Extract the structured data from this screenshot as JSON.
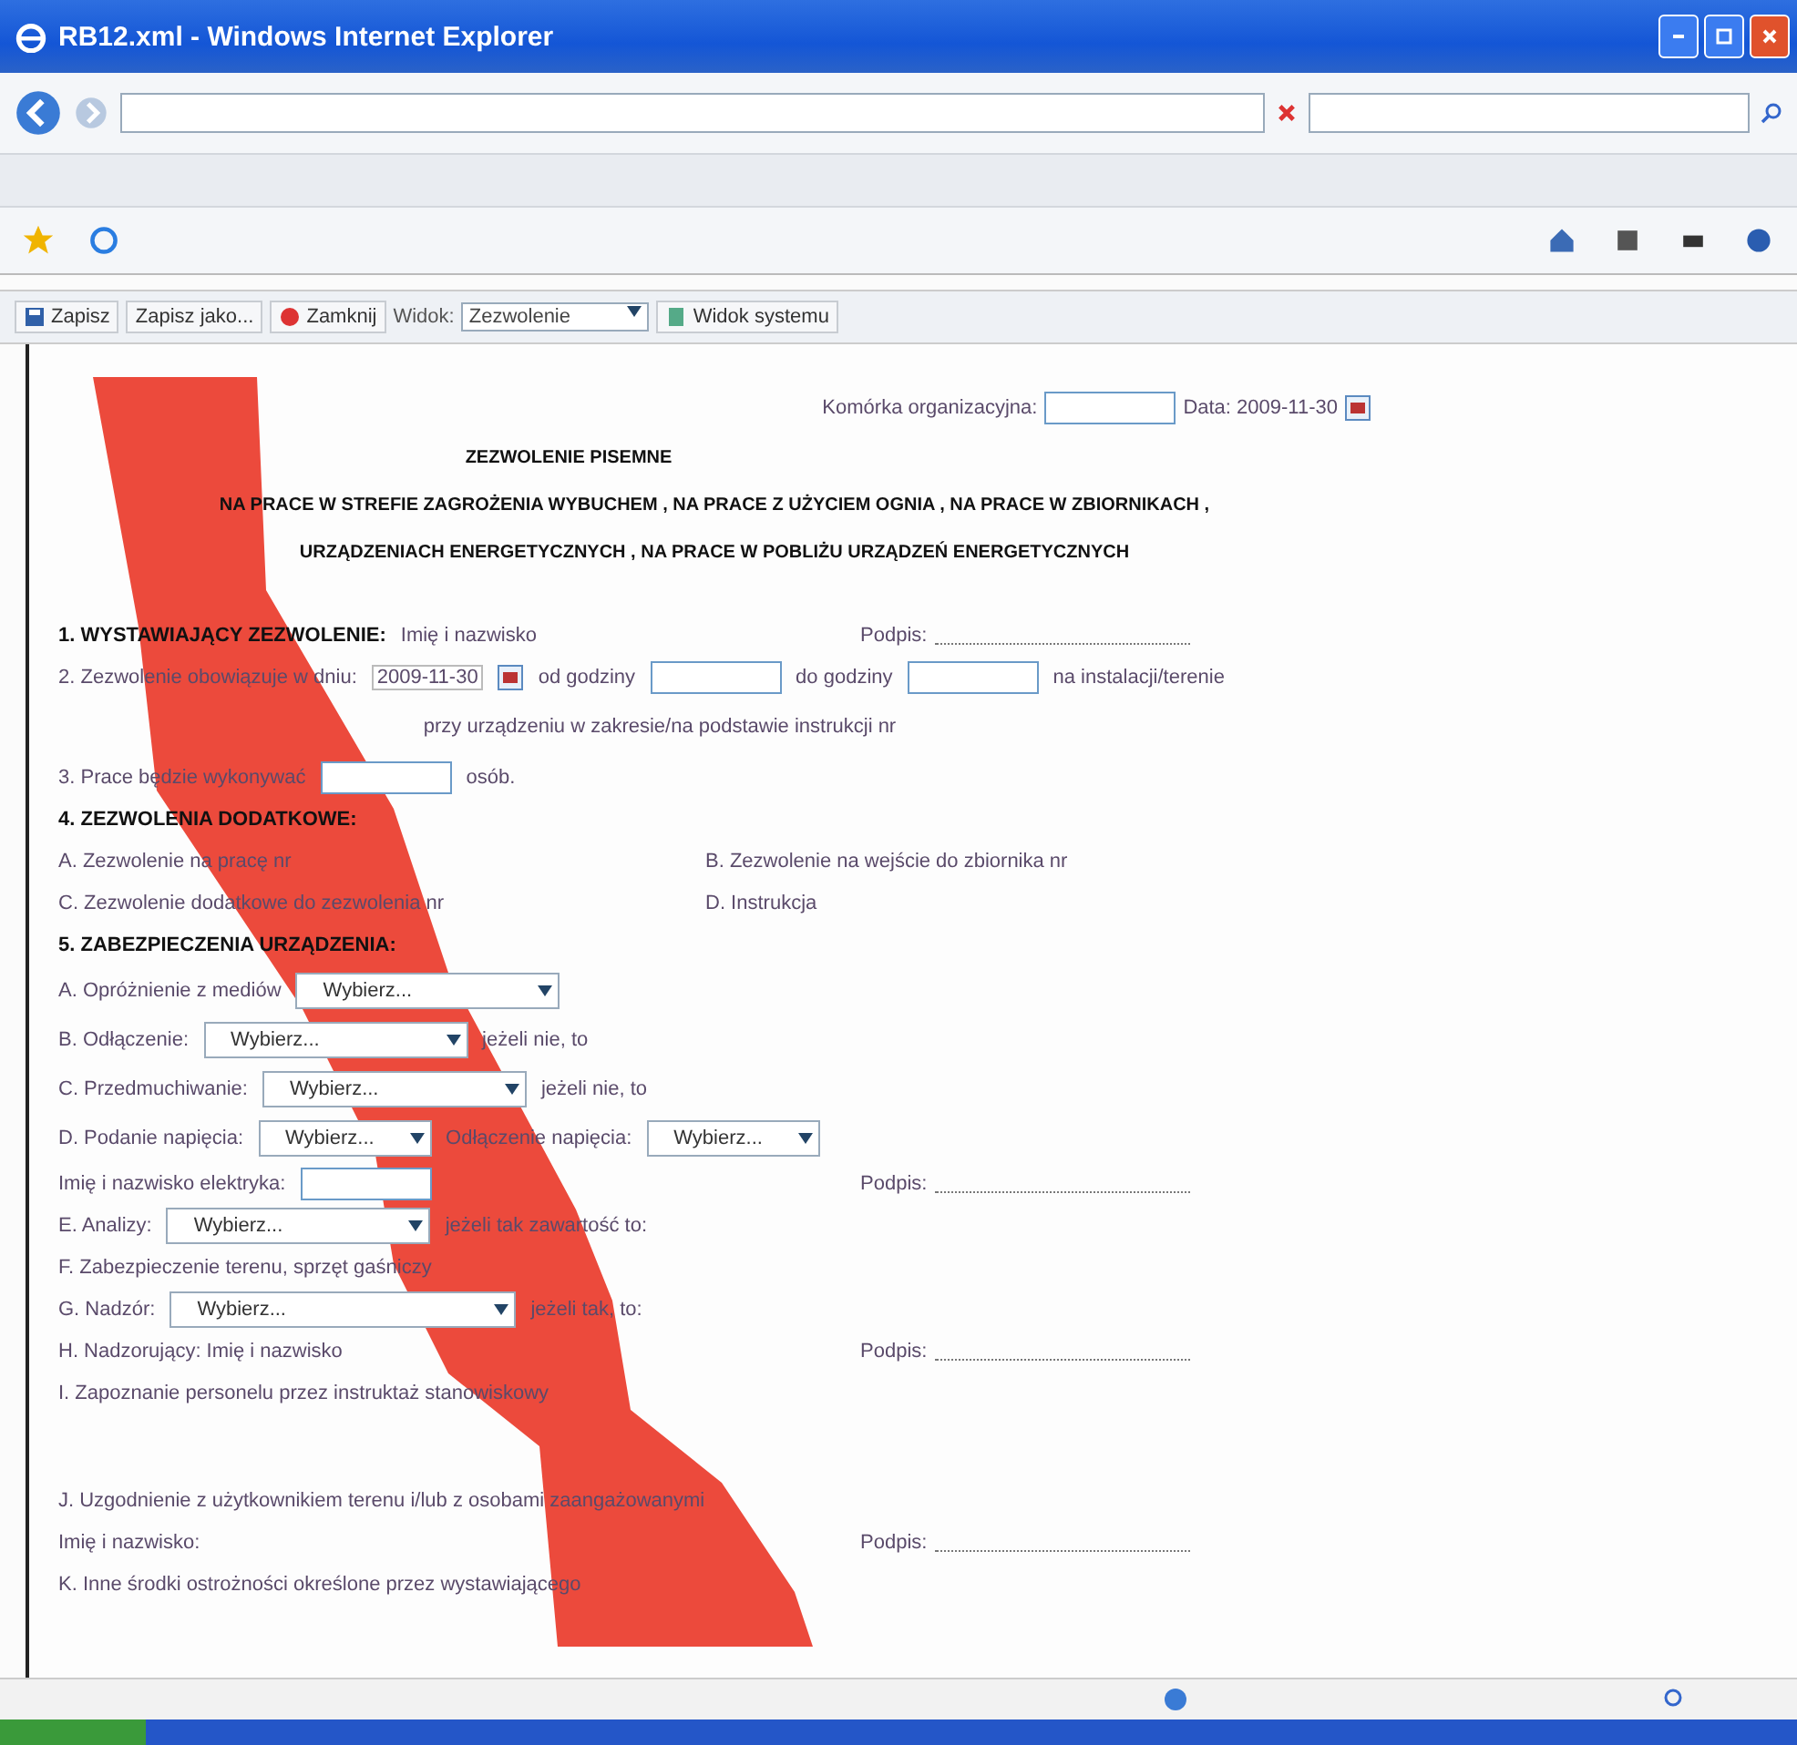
{
  "window": {
    "title": "RB12.xml - Windows Internet Explorer"
  },
  "command_bar": [
    {
      "kind": "button",
      "label": "Zapisz"
    },
    {
      "kind": "button",
      "label": "Zapisz jako..."
    },
    {
      "kind": "button",
      "label": "Zamknij"
    },
    {
      "kind": "label",
      "label": "Widok:"
    },
    {
      "kind": "select",
      "label": "Zezwolenie"
    },
    {
      "kind": "button",
      "label": "Widok systemu"
    }
  ],
  "form": {
    "header": {
      "unit_label": "Komórka organizacyjna:",
      "date_label": "Data: 2009-11-30"
    },
    "titles": [
      "ZEZWOLENIE PISEMNE",
      "NA PRACE W STREFIE ZAGROŻENIA WYBUCHEM , NA PRACE Z UŻYCIEM OGNIA , NA PRACE W ZBIORNIKACH ,",
      "URZĄDZENIACH ENERGETYCZNYCH , NA PRACE W POBLIŻU URZĄDZEŃ ENERGETYCZNYCH"
    ],
    "rows": [
      {
        "kind": "sign",
        "left": [
          {
            "kind": "bold",
            "text": "1. WYSTAWIAJĄCY ZEZWOLENIE:"
          },
          {
            "kind": "text",
            "text": "Imię i nazwisko"
          }
        ],
        "right": [
          {
            "kind": "text",
            "text": "Podpis:"
          },
          {
            "kind": "signature"
          }
        ]
      },
      {
        "kind": "line",
        "left": [
          {
            "kind": "text",
            "text": "2. Zezwolenie obowiązuje w dniu:"
          },
          {
            "kind": "date",
            "text": "2009-11-30"
          },
          {
            "kind": "calendar"
          },
          {
            "kind": "text",
            "text": "od godziny"
          },
          {
            "kind": "input"
          },
          {
            "kind": "text",
            "text": "do godziny"
          },
          {
            "kind": "input"
          },
          {
            "kind": "text",
            "text": "na instalacji/terenie"
          }
        ]
      },
      {
        "kind": "center",
        "left": [
          {
            "kind": "text",
            "text": "przy urządzeniu w zakresie/na podstawie instrukcji nr"
          }
        ]
      },
      {
        "kind": "line",
        "left": [
          {
            "kind": "text",
            "text": "3. Prace będzie wykonywać"
          },
          {
            "kind": "input"
          },
          {
            "kind": "text",
            "text": "osób."
          }
        ]
      },
      {
        "kind": "line",
        "left": [
          {
            "kind": "bold",
            "text": "4. ZEZWOLENIA DODATKOWE:"
          }
        ]
      },
      {
        "kind": "pair",
        "left": [
          {
            "kind": "text",
            "text": "A. Zezwolenie na pracę nr"
          }
        ],
        "right": [
          {
            "kind": "text",
            "text": "B. Zezwolenie na wejście do zbiornika nr"
          }
        ]
      },
      {
        "kind": "pair",
        "left": [
          {
            "kind": "text",
            "text": "C. Zezwolenie dodatkowe do zezwolenia nr"
          }
        ],
        "right": [
          {
            "kind": "text",
            "text": "D. Instrukcja"
          }
        ]
      },
      {
        "kind": "line",
        "left": [
          {
            "kind": "bold",
            "text": "5. ZABEZPIECZENIA URZĄDZENIA:"
          }
        ]
      },
      {
        "kind": "form",
        "left": [
          {
            "kind": "text",
            "text": "A. Opróżnienie z mediów"
          },
          {
            "kind": "select",
            "text": "Wybierz..."
          }
        ]
      },
      {
        "kind": "form",
        "left": [
          {
            "kind": "text",
            "text": "B. Odłączenie:"
          },
          {
            "kind": "select",
            "text": "Wybierz..."
          },
          {
            "kind": "text",
            "text": "jeżeli nie, to"
          }
        ]
      },
      {
        "kind": "form",
        "left": [
          {
            "kind": "text",
            "text": "C. Przedmuchiwanie:"
          },
          {
            "kind": "select",
            "text": "Wybierz..."
          },
          {
            "kind": "text",
            "text": "jeżeli nie, to"
          }
        ]
      },
      {
        "kind": "form",
        "left": [
          {
            "kind": "text",
            "text": "D. Podanie napięcia:"
          },
          {
            "kind": "select_short",
            "text": "Wybierz..."
          },
          {
            "kind": "text",
            "text": "Odłączenie napięcia:"
          },
          {
            "kind": "select_short",
            "text": "Wybierz..."
          }
        ]
      },
      {
        "kind": "sign",
        "left": [
          {
            "kind": "text",
            "text": "Imię i nazwisko elektryka:"
          },
          {
            "kind": "input"
          }
        ],
        "right": [
          {
            "kind": "text",
            "text": "Podpis:"
          },
          {
            "kind": "signature"
          }
        ]
      },
      {
        "kind": "line",
        "left": [
          {
            "kind": "text",
            "text": "E. Analizy:"
          },
          {
            "kind": "select",
            "text": "Wybierz..."
          },
          {
            "kind": "text",
            "text": "jeżeli tak zawartość to:"
          }
        ]
      },
      {
        "kind": "line",
        "left": [
          {
            "kind": "text",
            "text": "F. Zabezpieczenie terenu, sprzęt gaśniczy"
          }
        ]
      },
      {
        "kind": "line",
        "left": [
          {
            "kind": "text",
            "text": "G. Nadzór:"
          },
          {
            "kind": "select_long",
            "text": "Wybierz..."
          },
          {
            "kind": "text",
            "text": "jeżeli tak, to:"
          }
        ]
      },
      {
        "kind": "sign",
        "left": [
          {
            "kind": "text",
            "text": "H. Nadzorujący: Imię i nazwisko"
          }
        ],
        "right": [
          {
            "kind": "text",
            "text": "Podpis:"
          },
          {
            "kind": "signature"
          }
        ]
      },
      {
        "kind": "line",
        "left": [
          {
            "kind": "text",
            "text": "I. Zapoznanie personelu przez instruktaż stanowiskowy"
          }
        ]
      },
      {
        "kind": "gap",
        "left": [
          {
            "kind": "text",
            "text": "J. Uzgodnienie z użytkownikiem terenu i/lub z osobami zaangażowanymi"
          }
        ]
      },
      {
        "kind": "sign",
        "left": [
          {
            "kind": "text",
            "text": "Imię i nazwisko:"
          }
        ],
        "right": [
          {
            "kind": "text",
            "text": "Podpis:"
          },
          {
            "kind": "signature"
          }
        ]
      },
      {
        "kind": "line",
        "left": [
          {
            "kind": "text",
            "text": "K. Inne środki ostrożności określone przez wystawiającego"
          }
        ]
      }
    ]
  }
}
